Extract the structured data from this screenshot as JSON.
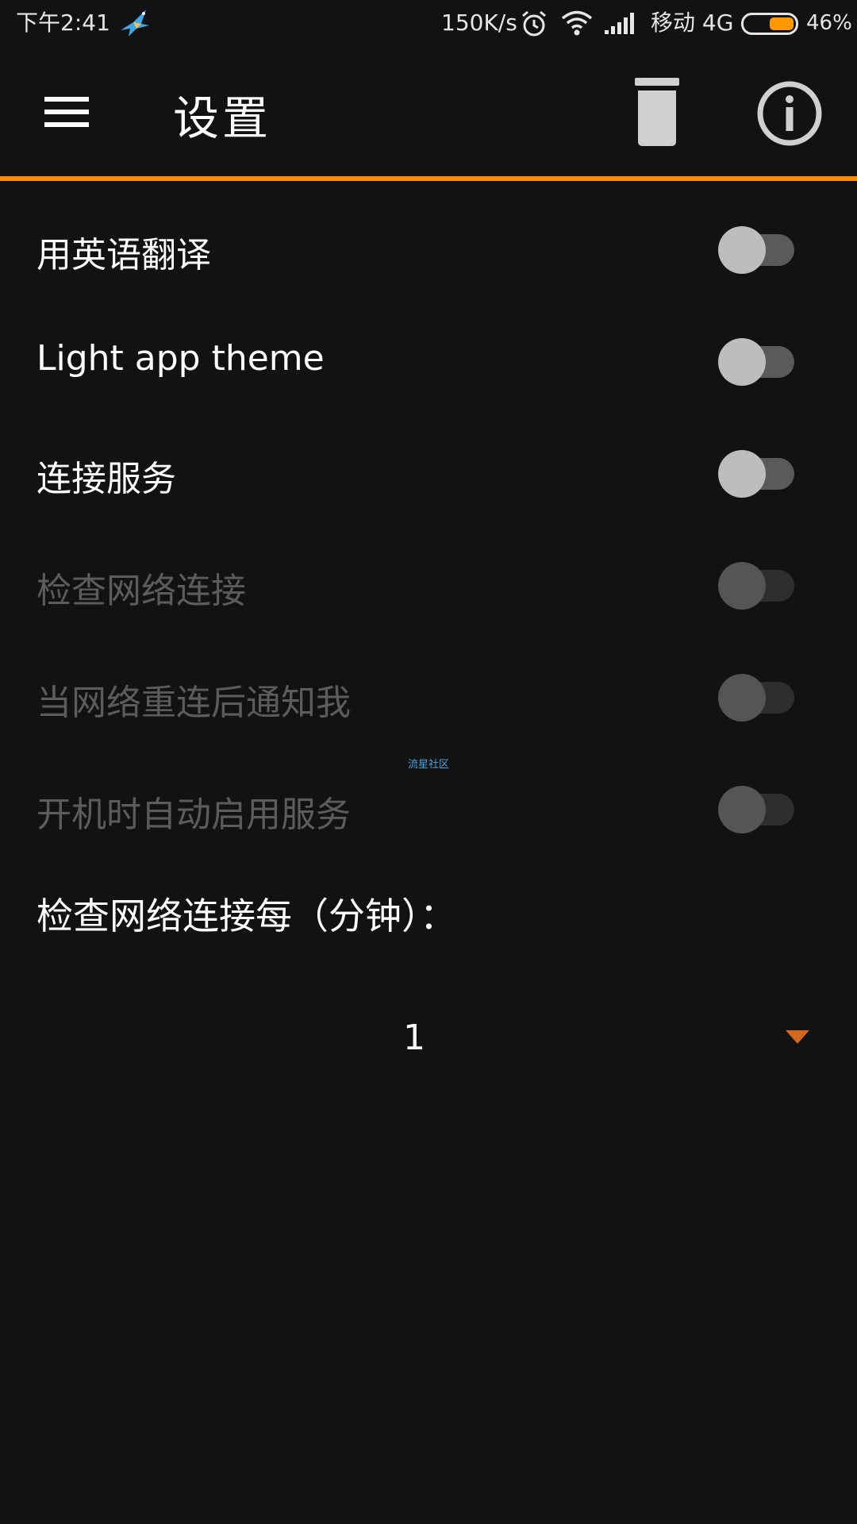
{
  "status_bar": {
    "time": "下午2:41",
    "net_speed": "150K/s",
    "carrier": "移动 4G",
    "battery_percent": "46%",
    "battery_level": 0.46,
    "icons": [
      "bird-app-icon",
      "alarm-icon",
      "wifi-icon",
      "signal-icon",
      "battery-icon"
    ]
  },
  "app_bar": {
    "title": "设置",
    "icons": [
      "menu-icon",
      "trash-icon",
      "info-icon"
    ]
  },
  "colors": {
    "background": "#121212",
    "accent": "#ff8a00",
    "dropdown_arrow": "#d2681e",
    "disabled_text": "#5c5c5c",
    "watermark": "#4aa3df"
  },
  "settings": [
    {
      "label": "用英语翻译",
      "enabled": true,
      "checked": false
    },
    {
      "label": "Light app theme",
      "enabled": true,
      "checked": false
    },
    {
      "label": "连接服务",
      "enabled": true,
      "checked": false
    },
    {
      "label": "检查网络连接",
      "enabled": false,
      "checked": false
    },
    {
      "label": "当网络重连后通知我",
      "enabled": false,
      "checked": false
    },
    {
      "label": "开机时自动启用服务",
      "enabled": false,
      "checked": false
    }
  ],
  "watermark": "流星社区",
  "interval": {
    "label": "检查网络连接每（分钟）：",
    "value": "1"
  }
}
